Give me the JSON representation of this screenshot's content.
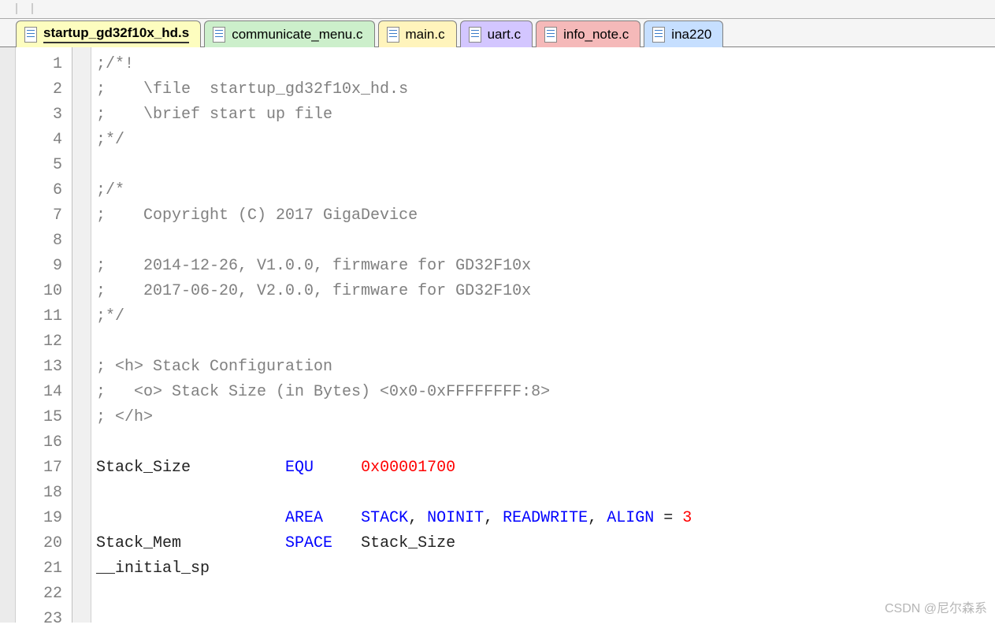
{
  "tabs": [
    {
      "label": "startup_gd32f10x_hd.s",
      "active": true,
      "cls": "active"
    },
    {
      "label": "communicate_menu.c",
      "active": false,
      "cls": "c1"
    },
    {
      "label": "main.c",
      "active": false,
      "cls": "c2"
    },
    {
      "label": "uart.c",
      "active": false,
      "cls": "c3"
    },
    {
      "label": "info_note.c",
      "active": false,
      "cls": "c4"
    },
    {
      "label": "ina220",
      "active": false,
      "cls": "c5"
    }
  ],
  "lines": [
    {
      "n": 1,
      "html": "<span class='g'>;/*!</span>"
    },
    {
      "n": 2,
      "html": "<span class='g'>;    \\file  startup_gd32f10x_hd.s</span>"
    },
    {
      "n": 3,
      "html": "<span class='g'>;    \\brief start up file</span>"
    },
    {
      "n": 4,
      "html": "<span class='g'>;*/</span>"
    },
    {
      "n": 5,
      "html": ""
    },
    {
      "n": 6,
      "html": "<span class='g'>;/*</span>"
    },
    {
      "n": 7,
      "html": "<span class='g'>;    Copyright (C) 2017 GigaDevice</span>"
    },
    {
      "n": 8,
      "html": ""
    },
    {
      "n": 9,
      "html": "<span class='g'>;    2014-12-26, V1.0.0, firmware for GD32F10x</span>"
    },
    {
      "n": 10,
      "html": "<span class='g'>;    2017-06-20, V2.0.0, firmware for GD32F10x</span>"
    },
    {
      "n": 11,
      "html": "<span class='g'>;*/</span>"
    },
    {
      "n": 12,
      "html": ""
    },
    {
      "n": 13,
      "html": "<span class='g'>; &lt;h&gt; Stack Configuration</span>"
    },
    {
      "n": 14,
      "html": "<span class='g'>;   &lt;o&gt; Stack Size (in Bytes) &lt;0x0-0xFFFFFFFF:8&gt;</span>"
    },
    {
      "n": 15,
      "html": "<span class='g'>; &lt;/h&gt;</span>"
    },
    {
      "n": 16,
      "html": ""
    },
    {
      "n": 17,
      "html": "<span class='id'>Stack_Size          </span><span class='kw'>EQU</span><span class='id'>     </span><span class='nm'>0x00001700</span>"
    },
    {
      "n": 18,
      "html": ""
    },
    {
      "n": 19,
      "html": "<span class='id'>                    </span><span class='kw'>AREA</span><span class='id'>    </span><span class='kw'>STACK</span><span class='id'>, </span><span class='kw'>NOINIT</span><span class='id'>, </span><span class='kw'>READWRITE</span><span class='id'>, </span><span class='kw'>ALIGN</span><span class='id'> = </span><span class='nm'>3</span>"
    },
    {
      "n": 20,
      "html": "<span class='id'>Stack_Mem           </span><span class='kw'>SPACE</span><span class='id'>   Stack_Size</span>"
    },
    {
      "n": 21,
      "html": "<span class='id'>__initial_sp</span>"
    },
    {
      "n": 22,
      "html": ""
    },
    {
      "n": 23,
      "html": ""
    }
  ],
  "watermark": "CSDN @尼尔森系"
}
